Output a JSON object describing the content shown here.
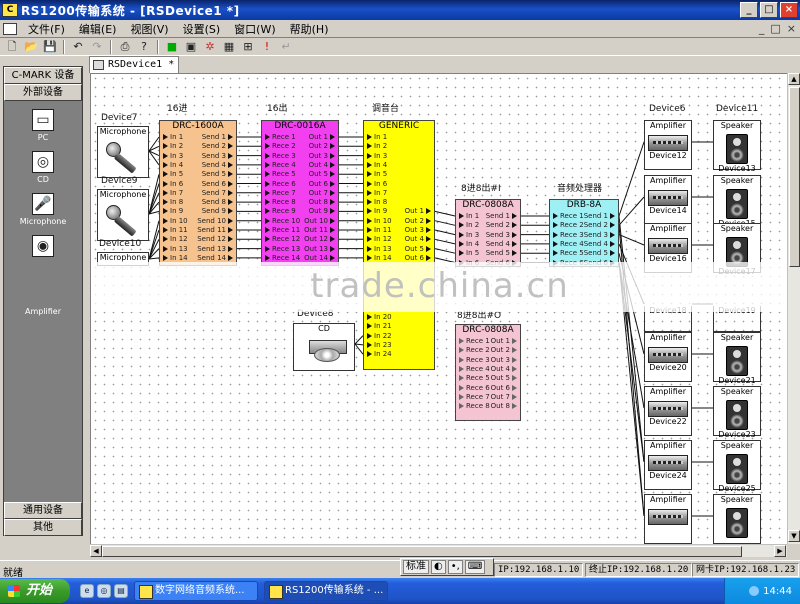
{
  "window": {
    "title": "RS1200传输系统 - [RSDevice1 *]",
    "min": "_",
    "max": "□",
    "close": "×"
  },
  "menu": {
    "items": [
      "文件(F)",
      "编辑(E)",
      "视图(V)",
      "设置(S)",
      "窗口(W)",
      "帮助(H)"
    ],
    "mdi": [
      "_",
      "□",
      "×"
    ]
  },
  "toolbar": {
    "buttons": [
      "new",
      "open",
      "save",
      "undo",
      "redo",
      "print",
      "help",
      "run",
      "monitor",
      "color",
      "grid",
      "layout",
      "alert",
      "enter"
    ]
  },
  "left_panel": {
    "top_buttons": [
      "C-MARK 设备",
      "外部设备"
    ],
    "devices": [
      {
        "label": "PC",
        "icon": "pc-icon"
      },
      {
        "label": "CD",
        "icon": "cd-icon"
      },
      {
        "label": "Microphone",
        "icon": "microphone-icon"
      },
      {
        "label": "Amplifier",
        "icon": "amplifier-icon"
      }
    ],
    "bottom_buttons": [
      "通用设备",
      "其他"
    ]
  },
  "document_tab": "RSDevice1 *",
  "diagram": {
    "group_labels": {
      "in16": "16进",
      "out16": "16出",
      "mixer": "调音台",
      "r86": "8进8出#I",
      "dsp": "音频处理器",
      "r86b": "8进8出#O"
    },
    "sources": [
      {
        "title": "Device7",
        "label": "Microphone"
      },
      {
        "title": "Device9",
        "label": "Microphone"
      },
      {
        "title": "Device10",
        "label": "Microphone"
      }
    ],
    "cd_source": {
      "title": "Device8",
      "label": "CD"
    },
    "blocks": {
      "drc1600a": {
        "name": "DRC-1600A",
        "color": "#f6c28e",
        "inputs": [
          "In 1",
          "In 2",
          "In 3",
          "In 4",
          "In 5",
          "In 6",
          "In 7",
          "In 8",
          "In 9",
          "In 10",
          "In 11",
          "In 12",
          "In 13",
          "In 14"
        ],
        "outputs": [
          "Send 1",
          "Send 2",
          "Send 3",
          "Send 4",
          "Send 5",
          "Send 6",
          "Send 7",
          "Send 8",
          "Send 9",
          "Send 10",
          "Send 11",
          "Send 12",
          "Send 13",
          "Send 14"
        ]
      },
      "drc0016a": {
        "name": "DRC-0016A",
        "color": "#f23ff0",
        "inputs": [
          "Rece 1",
          "Rece 2",
          "Rece 3",
          "Rece 4",
          "Rece 5",
          "Rece 6",
          "Rece 7",
          "Rece 8",
          "Rece 9",
          "Rece 10",
          "Rece 11",
          "Rece 12",
          "Rece 13",
          "Rece 14"
        ],
        "outputs": [
          "Out 1",
          "Out 2",
          "Out 3",
          "Out 4",
          "Out 5",
          "Out 6",
          "Out 7",
          "Out 8",
          "Out 9",
          "Out 10",
          "Out 11",
          "Out 12",
          "Out 13",
          "Out 14"
        ]
      },
      "generic": {
        "name": "GENERIC",
        "color": "#ffff00",
        "inputs": [
          "In 1",
          "In 2",
          "In 3",
          "In 4",
          "In 5",
          "In 6",
          "In 7",
          "In 8",
          "In 9",
          "In 10",
          "In 11",
          "In 12",
          "In 13",
          "In 14"
        ],
        "inputs_lower": [
          "In 20",
          "In 21",
          "In 22",
          "In 23",
          "In 24"
        ],
        "outputs": [
          "Out 1",
          "Out 2",
          "Out 3",
          "Out 4",
          "Out 5",
          "Out 6"
        ]
      },
      "drc0808a_1": {
        "name": "DRC-0808A",
        "color": "#f4c4d2",
        "inputs": [
          "In 1",
          "In 2",
          "In 3",
          "In 4",
          "In 5",
          "In 6"
        ],
        "outputs": [
          "Send 1",
          "Send 2",
          "Send 3",
          "Send 4",
          "Send 5",
          "Send 6"
        ]
      },
      "drb8a": {
        "name": "DRB-8A",
        "color": "#9ff0f4",
        "inputs": [
          "Rece 1",
          "Rece 2",
          "Rece 3",
          "Rece 4",
          "Rece 5",
          "Rece 6"
        ],
        "outputs": [
          "Send 1",
          "Send 2",
          "Send 3",
          "Send 4",
          "Send 5",
          "Send 6"
        ]
      },
      "drc0808a_2": {
        "name": "DRC-0808A",
        "color": "#f4c4d2",
        "inputs": [
          "Rece 1",
          "Rece 2",
          "Rece 3",
          "Rece 4",
          "Rece 5",
          "Rece 6",
          "Rece 7",
          "Rece 8"
        ],
        "outputs": [
          "Out 1",
          "Out 2",
          "Out 3",
          "Out 4",
          "Out 5",
          "Out 6",
          "Out 7",
          "Out 8"
        ]
      }
    },
    "amp_column_title": "Device6",
    "spk_column_title": "Device11",
    "amps": [
      {
        "label": "Amplifier",
        "name": "Device12"
      },
      {
        "label": "Amplifier",
        "name": "Device14"
      },
      {
        "label": "Amplifier",
        "name": "Device16"
      },
      {
        "label": "",
        "name": "Device18"
      },
      {
        "label": "Amplifier",
        "name": "Device20"
      },
      {
        "label": "Amplifier",
        "name": "Device22"
      },
      {
        "label": "Amplifier",
        "name": "Device24"
      },
      {
        "label": "Amplifier",
        "name": ""
      }
    ],
    "speakers": [
      {
        "label": "Speaker",
        "name": "Device13"
      },
      {
        "label": "Speaker",
        "name": "Device15"
      },
      {
        "label": "Speaker",
        "name": "Device17"
      },
      {
        "label": "",
        "name": "Device19"
      },
      {
        "label": "Speaker",
        "name": "Device21"
      },
      {
        "label": "Speaker",
        "name": "Device23"
      },
      {
        "label": "Speaker",
        "name": "Device25"
      },
      {
        "label": "Speaker",
        "name": ""
      }
    ],
    "watermark": "trade.china.cn"
  },
  "status": {
    "ready": "就绪",
    "ime": [
      "标准",
      "◐",
      "•,",
      "⌨"
    ],
    "start_ip": "IP:192.168.1.10",
    "end_ip": "终止IP:192.168.1.20",
    "nic_ip": "网卡IP:192.168.1.23"
  },
  "taskbar": {
    "start": "开始",
    "quicklaunch": [
      "e",
      "◎",
      "▤"
    ],
    "tasks": [
      "数字网络音频系统...",
      "RS1200传输系统 - ..."
    ],
    "clock": "14:44"
  }
}
